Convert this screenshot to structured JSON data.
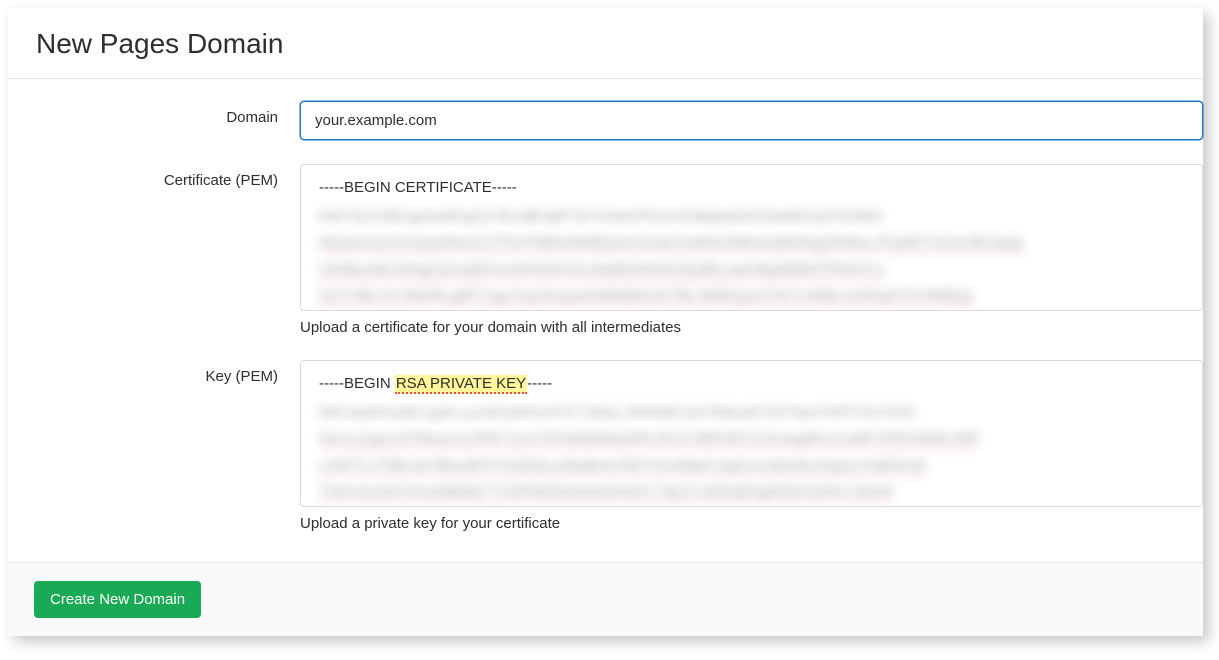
{
  "header": {
    "title": "New Pages Domain"
  },
  "form": {
    "domain": {
      "label": "Domain",
      "value": "your.example.com"
    },
    "certificate": {
      "label": "Certificate (PEM)",
      "first_line": "-----BEGIN CERTIFICATE-----",
      "help": "Upload a certificate for your domain with all intermediates"
    },
    "key": {
      "label": "Key (PEM)",
      "first_line_prefix": "-----BEGIN ",
      "first_line_highlight": "RSA PRIVATE KEY",
      "first_line_suffix": "-----",
      "help": "Upload a private key for your certificate"
    }
  },
  "footer": {
    "submit_label": "Create New Domain"
  }
}
